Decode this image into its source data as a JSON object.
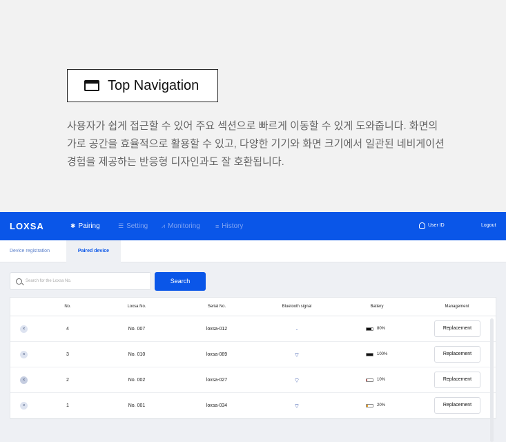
{
  "hero": {
    "title": "Top Navigation",
    "description": "사용자가 쉽게 접근할 수 있어 주요 섹션으로 빠르게 이동할 수 있게 도와줍니다. 화면의 가로 공간을 효율적으로 활용할 수 있고, 다양한 기기와 화면 크기에서 일관된 네비게이션 경험을 제공하는 반응형 디자인과도 잘 호환됩니다."
  },
  "app": {
    "logo": "LOXSA",
    "nav": [
      {
        "label": "Pairing",
        "icon": "bluetooth-icon"
      },
      {
        "label": "Setting",
        "icon": "sliders-icon"
      },
      {
        "label": "Monitoring",
        "icon": "chart-icon"
      },
      {
        "label": "History",
        "icon": "list-icon"
      }
    ],
    "user_id": "User ID",
    "logout": "Logout",
    "tabs": [
      "Device registration",
      "Paired device"
    ],
    "search": {
      "placeholder": "Search for the Loxsa No.",
      "button": "Search"
    },
    "table": {
      "headers": [
        "No.",
        "Loxsa No.",
        "Serial No.",
        "Bluetooth signal",
        "Battery",
        "Management"
      ],
      "rows": [
        {
          "no": "4",
          "loxsa_no": "No. 007",
          "serial": "loxsa-012",
          "battery": "80%",
          "battery_level": 0.8,
          "battery_color": "#111111",
          "action": "Replacement"
        },
        {
          "no": "3",
          "loxsa_no": "No. 010",
          "serial": "loxsa-089",
          "battery": "100%",
          "battery_level": 1.0,
          "battery_color": "#111111",
          "action": "Replacement"
        },
        {
          "no": "2",
          "loxsa_no": "No. 002",
          "serial": "loxsa-027",
          "battery": "10%",
          "battery_level": 0.1,
          "battery_color": "#e53935",
          "action": "Replacement"
        },
        {
          "no": "1",
          "loxsa_no": "No. 001",
          "serial": "loxsa-034",
          "battery": "20%",
          "battery_level": 0.2,
          "battery_color": "#f5a623",
          "action": "Replacement"
        }
      ]
    },
    "colors": {
      "primary": "#0a56e8"
    }
  }
}
